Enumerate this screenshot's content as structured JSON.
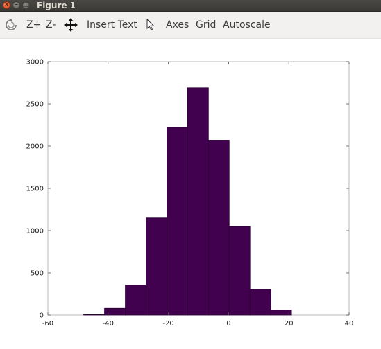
{
  "window": {
    "title": "Figure 1"
  },
  "toolbar": {
    "zoom_in": "Z+",
    "zoom_out": "Z-",
    "insert_text": "Insert Text",
    "axes": "Axes",
    "grid": "Grid",
    "autoscale": "Autoscale"
  },
  "chart_data": {
    "type": "bar",
    "title": "",
    "xlabel": "",
    "ylabel": "",
    "xlim": [
      -60,
      40
    ],
    "ylim": [
      0,
      3000
    ],
    "xticks": [
      -60,
      -40,
      -20,
      0,
      20,
      40
    ],
    "yticks": [
      0,
      500,
      1000,
      1500,
      2000,
      2500,
      3000
    ],
    "bar_color": "#42014f",
    "bins": [
      {
        "x0": -48.1,
        "x1": -41.2,
        "value": 5
      },
      {
        "x0": -41.2,
        "x1": -34.3,
        "value": 80
      },
      {
        "x0": -34.3,
        "x1": -27.4,
        "value": 355
      },
      {
        "x0": -27.4,
        "x1": -20.5,
        "value": 1150
      },
      {
        "x0": -20.5,
        "x1": -13.6,
        "value": 2220
      },
      {
        "x0": -13.6,
        "x1": -6.7,
        "value": 2690
      },
      {
        "x0": -6.7,
        "x1": 0.2,
        "value": 2070
      },
      {
        "x0": 0.2,
        "x1": 7.1,
        "value": 1050
      },
      {
        "x0": 7.1,
        "x1": 14.0,
        "value": 305
      },
      {
        "x0": 14.0,
        "x1": 20.9,
        "value": 60
      }
    ]
  }
}
